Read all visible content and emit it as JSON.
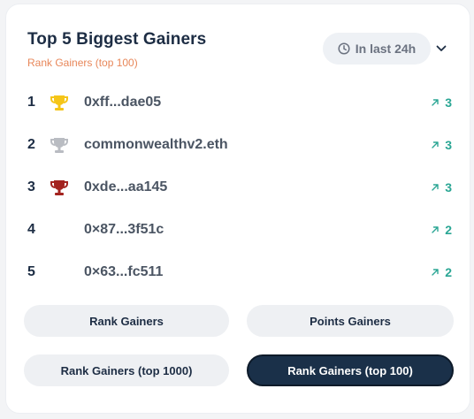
{
  "header": {
    "title": "Top 5 Biggest Gainers",
    "subtitle": "Rank Gainers (top 100)",
    "period_label": "In last 24h"
  },
  "gainers": [
    {
      "rank": "1",
      "name": "0xff...dae05",
      "change": "3",
      "trophy": "gold-trophy-icon",
      "trophy_color": "#f5c518"
    },
    {
      "rank": "2",
      "name": "commonwealthv2.eth",
      "change": "3",
      "trophy": "silver-trophy-icon",
      "trophy_color": "#b9bcc2"
    },
    {
      "rank": "3",
      "name": "0xde...aa145",
      "change": "3",
      "trophy": "bronze-trophy-icon",
      "trophy_color": "#a3231f"
    },
    {
      "rank": "4",
      "name": "0×87...3f51c",
      "change": "2",
      "trophy": "",
      "trophy_color": ""
    },
    {
      "rank": "5",
      "name": "0×63...fc511",
      "change": "2",
      "trophy": "",
      "trophy_color": ""
    }
  ],
  "filters": {
    "rank_gainers": "Rank Gainers",
    "points_gainers": "Points Gainers",
    "rank_gainers_top_1000": "Rank Gainers (top 1000)",
    "rank_gainers_top_100": "Rank Gainers (top 100)",
    "selected": "Rank Gainers (top 100)"
  },
  "colors": {
    "accent_dark": "#1a3049",
    "positive": "#2aa694",
    "subtitle": "#e8875a"
  }
}
